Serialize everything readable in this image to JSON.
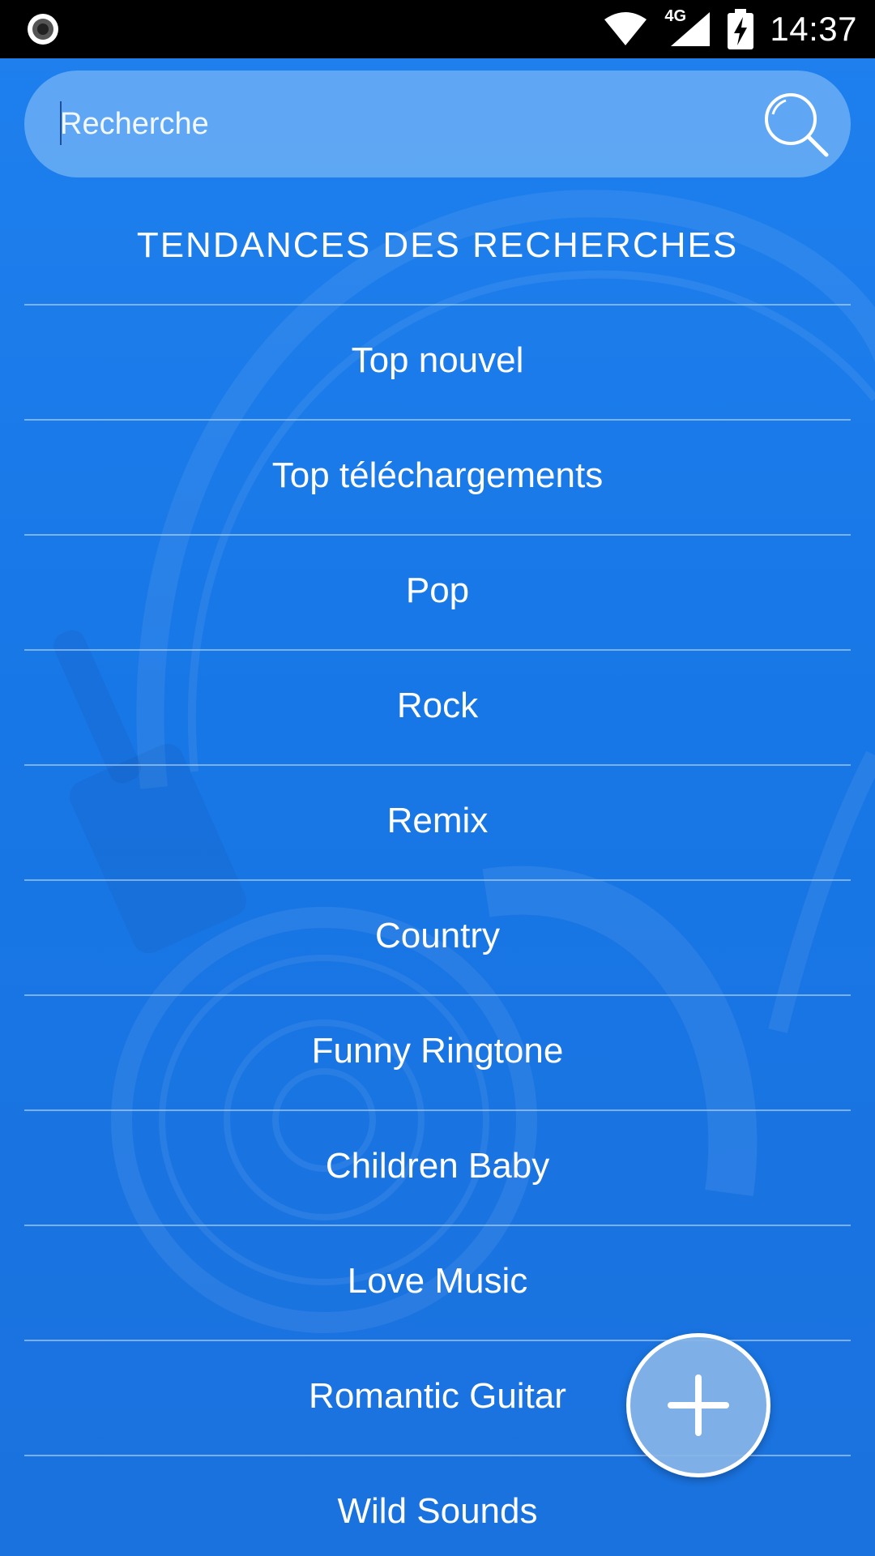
{
  "status_bar": {
    "time": "14:37",
    "network": "4G",
    "icons": [
      "record-icon",
      "wifi-icon",
      "signal-icon",
      "battery-charging-icon"
    ]
  },
  "search": {
    "placeholder": "Recherche",
    "value": "",
    "icon": "search-icon"
  },
  "trending": {
    "title": "TENDANCES DES RECHERCHES",
    "items": [
      {
        "label": "Top nouvel"
      },
      {
        "label": "Top téléchargements"
      },
      {
        "label": "Pop"
      },
      {
        "label": "Rock"
      },
      {
        "label": "Remix"
      },
      {
        "label": "Country"
      },
      {
        "label": "Funny Ringtone"
      },
      {
        "label": "Children Baby"
      },
      {
        "label": "Love Music"
      },
      {
        "label": "Romantic Guitar"
      },
      {
        "label": "Wild Sounds"
      }
    ]
  },
  "fab": {
    "icon": "plus-icon"
  },
  "colors": {
    "background": "#1a7ae6",
    "status_bar": "#000000",
    "text": "#ffffff",
    "search_fill": "#7fb8f5"
  }
}
